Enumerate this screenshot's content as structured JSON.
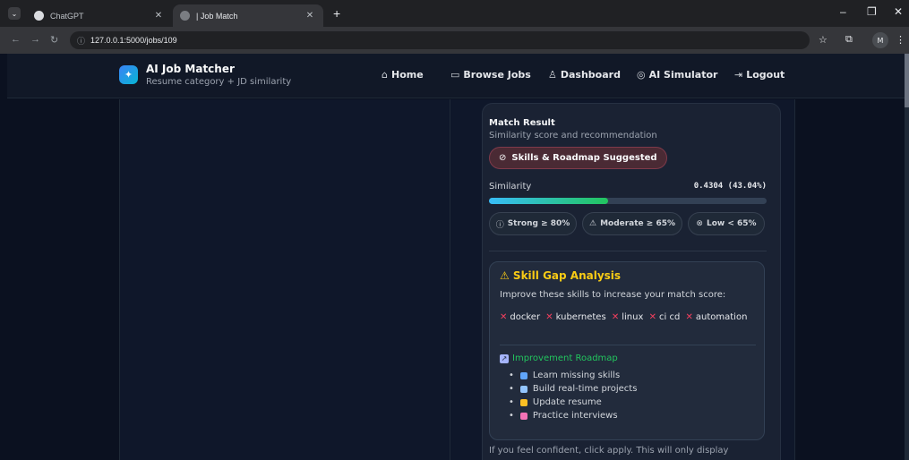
{
  "browser": {
    "tabs": [
      {
        "title": "ChatGPT",
        "active": false
      },
      {
        "title": "| Job Match",
        "active": true
      }
    ],
    "url": "127.0.0.1:5000/jobs/109",
    "profile_initial": "M"
  },
  "nav": {
    "brand_title": "AI Job Matcher",
    "brand_subtitle": "Resume category + JD similarity",
    "links": [
      {
        "label": "Home",
        "icon": "home-icon"
      },
      {
        "label": "Browse Jobs",
        "icon": "briefcase-icon"
      },
      {
        "label": "Dashboard",
        "icon": "user-icon"
      },
      {
        "label": "AI Simulator",
        "icon": "target-icon"
      },
      {
        "label": "Logout",
        "icon": "logout-icon"
      }
    ]
  },
  "match": {
    "title": "Match Result",
    "subtitle": "Similarity score and recommendation",
    "verdict": "Skills & Roadmap Suggested",
    "similarity_label": "Similarity",
    "similarity_value": "0.4304 (43.04%)",
    "similarity_fraction": 0.4304,
    "thresholds": [
      {
        "label": "Strong ≥ 80%",
        "icon": "info-icon"
      },
      {
        "label": "Moderate ≥ 65%",
        "icon": "warning-icon"
      },
      {
        "label": "Low < 65%",
        "icon": "x-circle-icon"
      }
    ]
  },
  "skill_gap": {
    "title": "⚠ Skill Gap Analysis",
    "subtitle": "Improve these skills to increase your match score:",
    "missing_skills": [
      "docker",
      "kubernetes",
      "linux",
      "ci cd",
      "automation"
    ],
    "roadmap_title": "Improvement Roadmap",
    "roadmap": [
      {
        "text": "Learn missing skills",
        "color": "#60a5fa"
      },
      {
        "text": "Build real-time projects",
        "color": "#93c5fd"
      },
      {
        "text": "Update resume",
        "color": "#fbbf24"
      },
      {
        "text": "Practice interviews",
        "color": "#f472b6"
      }
    ]
  },
  "footer_note": "If you feel confident, click apply. This will only display",
  "colors": {
    "accent_warning": "#facc15",
    "accent_success": "#22c55e",
    "missing_x": "#f43f5e"
  }
}
